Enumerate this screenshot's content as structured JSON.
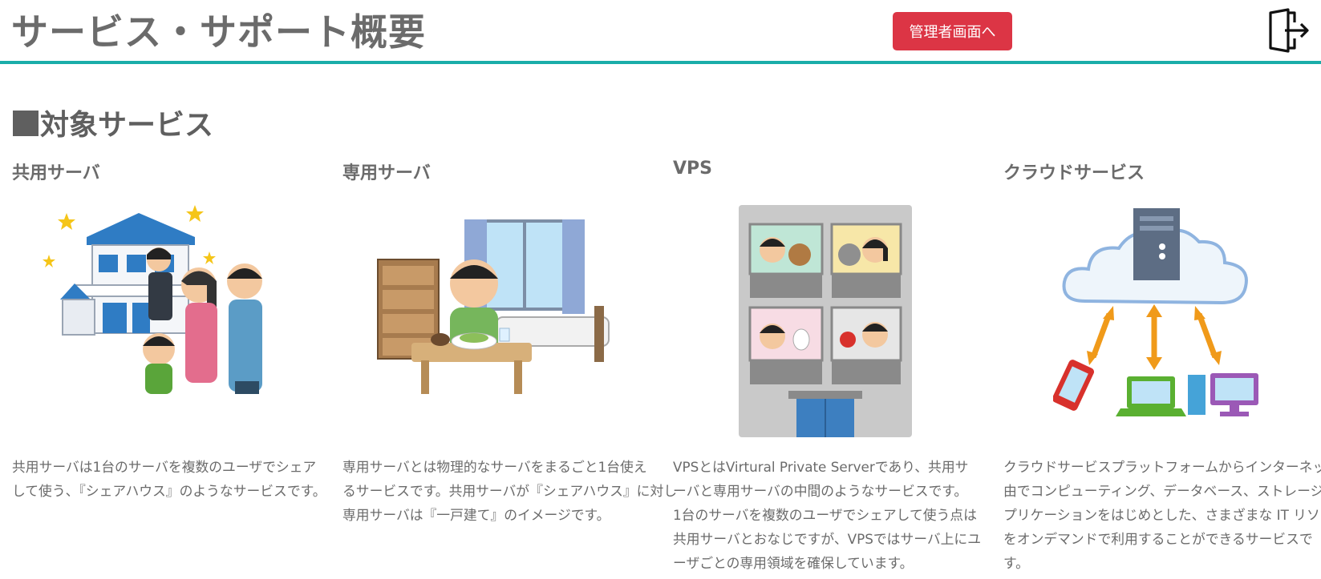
{
  "header": {
    "title": "サービス・サポート概要",
    "admin_button": "管理者画面へ",
    "logout_icon": "logout-door-arrow",
    "accent_color": "#1aada9",
    "button_color": "#dc3545"
  },
  "section": {
    "title": "対象サービス"
  },
  "services": [
    {
      "name": "共用サーバ",
      "illustration": "family-house",
      "lines": [
        "共用サーバは1台のサーバを複数のユーザでシェア",
        "して使う、『シェアハウス』のようなサービスです。"
      ]
    },
    {
      "name": "専用サーバ",
      "illustration": "person-room",
      "lines": [
        "専用サーバとは物理的なサーバをまるごと1台使え",
        "るサービスです。共用サーバが『シェアハウス』に対し",
        "専用サーバは『一戸建て』のイメージです。"
      ]
    },
    {
      "name": "VPS",
      "illustration": "apartment-building",
      "lines": [
        "VPSとはVirtural Private Serverであり、共用サ",
        "ーバと専用サーバの中間のようなサービスです。",
        "1台のサーバを複数のユーザでシェアして使う点は",
        "共用サーバとおなじですが、VPSではサーバ上にユ",
        "ーザごとの専用領域を確保しています。"
      ]
    },
    {
      "name": "クラウドサービス",
      "illustration": "cloud-server-devices",
      "lines": [
        "クラウドサービスプラットフォームからインターネット経",
        "由でコンピューティング、データベース、ストレージ、ア",
        "プリケーションをはじめとした、さまざまな IT リソース",
        "をオンデマンドで利用することができるサービスで",
        "す。"
      ]
    }
  ]
}
